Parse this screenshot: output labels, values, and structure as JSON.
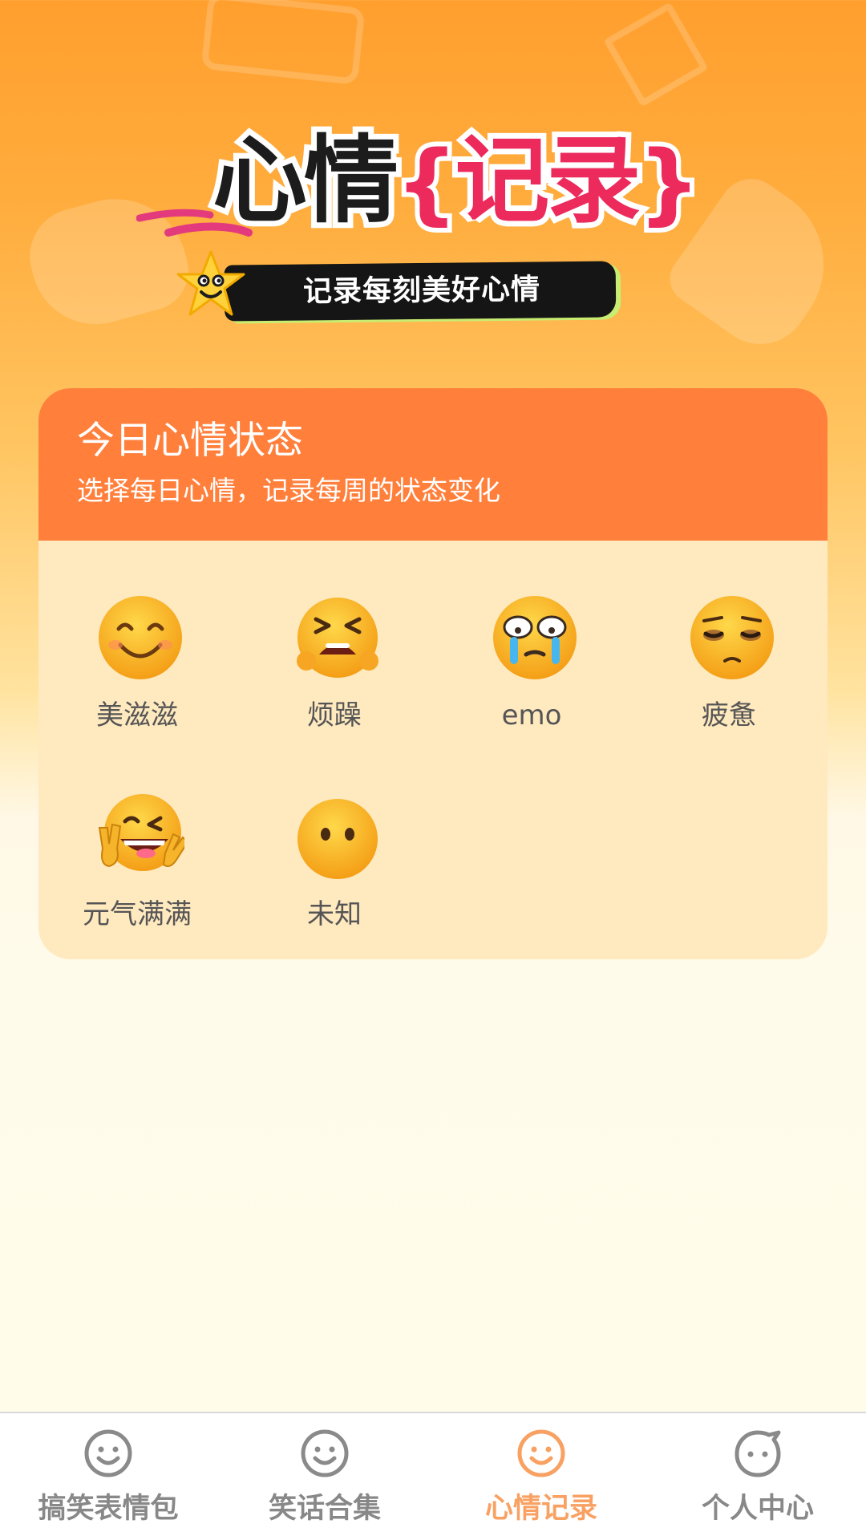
{
  "banner": {
    "title_black": "心情",
    "title_pink": "记录",
    "subtitle": "记录每刻美好心情"
  },
  "mood_card": {
    "title": "今日心情状态",
    "subtitle": "选择每日心情，记录每周的状态变化",
    "moods": [
      {
        "label": "美滋滋",
        "icon": "smiling-face-icon"
      },
      {
        "label": "烦躁",
        "icon": "tired-face-icon"
      },
      {
        "label": "emo",
        "icon": "crying-face-icon"
      },
      {
        "label": "疲惫",
        "icon": "weary-pensive-face-icon"
      },
      {
        "label": "元气满满",
        "icon": "victory-hands-grin-icon"
      },
      {
        "label": "未知",
        "icon": "blank-face-icon"
      }
    ]
  },
  "tabbar": {
    "tabs": [
      {
        "label": "搞笑表情包",
        "icon": "smiley-icon",
        "active": false
      },
      {
        "label": "笑话合集",
        "icon": "smiley-icon",
        "active": false
      },
      {
        "label": "心情记录",
        "icon": "smiley-icon",
        "active": true
      },
      {
        "label": "个人中心",
        "icon": "profile-face-icon",
        "active": false
      }
    ]
  },
  "colors": {
    "accent": "#ff7f3b",
    "active_tab": "#f8a162",
    "inactive_tab": "#888888",
    "title_pink": "#ec2a5c"
  }
}
